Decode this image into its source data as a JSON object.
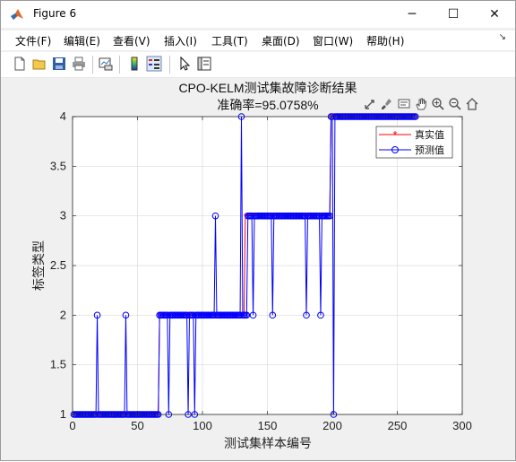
{
  "window": {
    "title": "Figure 6",
    "controls": {
      "minimize": "─",
      "maximize": "☐",
      "close": "✕"
    }
  },
  "menu": {
    "items": [
      "文件(F)",
      "编辑(E)",
      "查看(V)",
      "插入(I)",
      "工具(T)",
      "桌面(D)",
      "窗口(W)",
      "帮助(H)"
    ],
    "overflow": "↘"
  },
  "toolbar": {
    "icons": [
      "new-figure-icon",
      "open-file-icon",
      "save-icon",
      "print-icon",
      "link-plot-icon",
      "colorbar-icon",
      "legend-icon",
      "pointer-icon",
      "property-inspector-icon"
    ]
  },
  "axes_toolbar": {
    "icons": [
      "export-icon",
      "brush-icon",
      "datatip-icon",
      "pan-icon",
      "zoom-in-icon",
      "zoom-out-icon",
      "home-icon"
    ]
  },
  "chart_data": {
    "type": "line",
    "title": "CPO-KELM测试集故障诊断结果",
    "subtitle": "准确率=95.0758%",
    "xlabel": "测试集样本编号",
    "ylabel": "标签类型",
    "xlim": [
      0,
      300
    ],
    "ylim": [
      1,
      4
    ],
    "xticks": [
      0,
      50,
      100,
      150,
      200,
      250,
      300
    ],
    "yticks": [
      1,
      1.5,
      2,
      2.5,
      3,
      3.5,
      4
    ],
    "xtick_labels": [
      "0",
      "50",
      "100",
      "150",
      "200",
      "250",
      "300"
    ],
    "ytick_labels": [
      "1",
      "1.5",
      "2",
      "2.5",
      "3",
      "3.5",
      "4"
    ],
    "grid": true,
    "legend_position": "top-right",
    "n_samples": 264,
    "series": [
      {
        "name": "真实值",
        "color": "#ff0000",
        "marker": "*",
        "segments": [
          {
            "from": 1,
            "to": 66,
            "value": 1
          },
          {
            "from": 67,
            "to": 132,
            "value": 2
          },
          {
            "from": 133,
            "to": 198,
            "value": 3
          },
          {
            "from": 199,
            "to": 264,
            "value": 4
          }
        ]
      },
      {
        "name": "预测值",
        "color": "#0000ff",
        "marker": "o",
        "base_segments": [
          {
            "from": 1,
            "to": 66,
            "value": 1
          },
          {
            "from": 67,
            "to": 132,
            "value": 2
          },
          {
            "from": 133,
            "to": 198,
            "value": 3
          },
          {
            "from": 199,
            "to": 264,
            "value": 4
          }
        ],
        "errors": [
          {
            "x": 19,
            "y": 2
          },
          {
            "x": 41,
            "y": 2
          },
          {
            "x": 74,
            "y": 1
          },
          {
            "x": 89,
            "y": 1
          },
          {
            "x": 94,
            "y": 1
          },
          {
            "x": 110,
            "y": 3
          },
          {
            "x": 130,
            "y": 4
          },
          {
            "x": 133,
            "y": 2
          },
          {
            "x": 134,
            "y": 2
          },
          {
            "x": 139,
            "y": 2
          },
          {
            "x": 154,
            "y": 2
          },
          {
            "x": 180,
            "y": 2
          },
          {
            "x": 191,
            "y": 2
          },
          {
            "x": 201,
            "y": 1
          }
        ]
      }
    ]
  }
}
